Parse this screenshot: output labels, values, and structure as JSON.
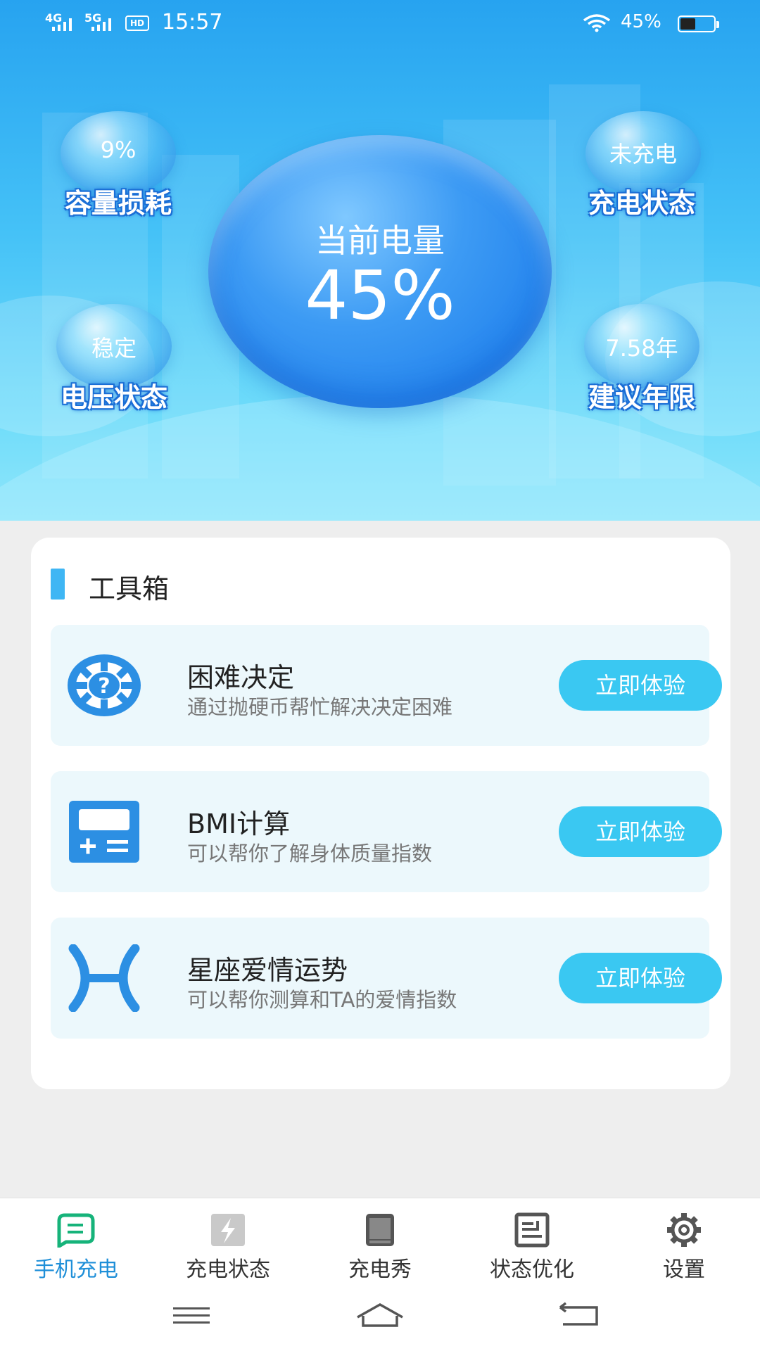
{
  "status_bar": {
    "network_1": "4G",
    "network_2": "5G",
    "time": "15:57",
    "battery_text": "45%",
    "battery_level": 0.45
  },
  "hero": {
    "main_title": "当前电量",
    "main_value": "45%",
    "stats": [
      {
        "value": "9%",
        "label": "容量损耗"
      },
      {
        "value": "未充电",
        "label": "充电状态"
      },
      {
        "value": "稳定",
        "label": "电压状态"
      },
      {
        "value": "7.58年",
        "label": "建议年限"
      }
    ]
  },
  "toolbox": {
    "title": "工具箱",
    "items": [
      {
        "title": "困难决定",
        "desc": "通过抛硬币帮忙解决决定困难",
        "button": "立即体验",
        "icon": "question-gear-icon"
      },
      {
        "title": "BMI计算",
        "desc": "可以帮你了解身体质量指数",
        "button": "立即体验",
        "icon": "calculator-icon"
      },
      {
        "title": "星座爱情运势",
        "desc": "可以帮你测算和TA的爱情指数",
        "button": "立即体验",
        "icon": "pisces-icon"
      }
    ]
  },
  "nav": {
    "items": [
      {
        "label": "手机充电",
        "icon": "phone-charge-icon"
      },
      {
        "label": "充电状态",
        "icon": "charge-status-icon"
      },
      {
        "label": "充电秀",
        "icon": "charge-show-icon"
      },
      {
        "label": "状态优化",
        "icon": "optimize-icon"
      },
      {
        "label": "设置",
        "icon": "gear-icon"
      }
    ]
  },
  "colors": {
    "accent": "#3ac8f2",
    "active_nav": "#1f8fd8",
    "hero_blue": "#27a3f0"
  }
}
